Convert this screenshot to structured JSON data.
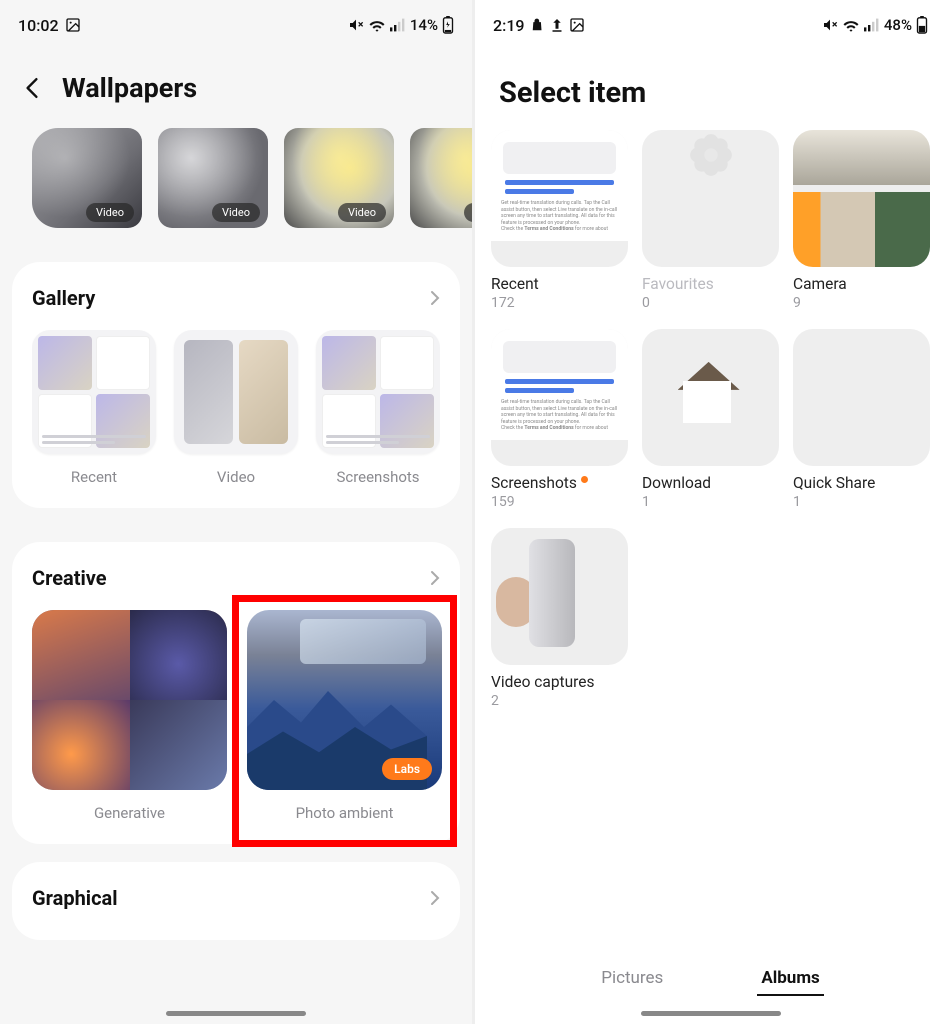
{
  "left": {
    "status": {
      "time": "10:02",
      "battery_text": "14%"
    },
    "header_title": "Wallpapers",
    "video_badge": "Video",
    "sections": {
      "gallery": {
        "title": "Gallery",
        "items": [
          "Recent",
          "Video",
          "Screenshots"
        ]
      },
      "creative": {
        "title": "Creative",
        "items": [
          "Generative",
          "Photo ambient"
        ],
        "labs_label": "Labs"
      },
      "graphical": {
        "title": "Graphical"
      }
    }
  },
  "right": {
    "status": {
      "time": "2:19",
      "battery_text": "48%"
    },
    "header_title": "Select item",
    "albums": [
      {
        "label": "Recent",
        "count": "172",
        "kind": "screenshot"
      },
      {
        "label": "Favourites",
        "count": "0",
        "kind": "fav",
        "faded": true
      },
      {
        "label": "Camera",
        "count": "9",
        "kind": "cam"
      },
      {
        "label": "Screenshots",
        "count": "159",
        "kind": "screenshot",
        "dot": true
      },
      {
        "label": "Download",
        "count": "1",
        "kind": "dl"
      },
      {
        "label": "Quick Share",
        "count": "1",
        "kind": "qs"
      },
      {
        "label": "Video captures",
        "count": "2",
        "kind": "vc"
      }
    ],
    "tabs": {
      "pictures": "Pictures",
      "albums": "Albums",
      "active": "albums"
    }
  }
}
